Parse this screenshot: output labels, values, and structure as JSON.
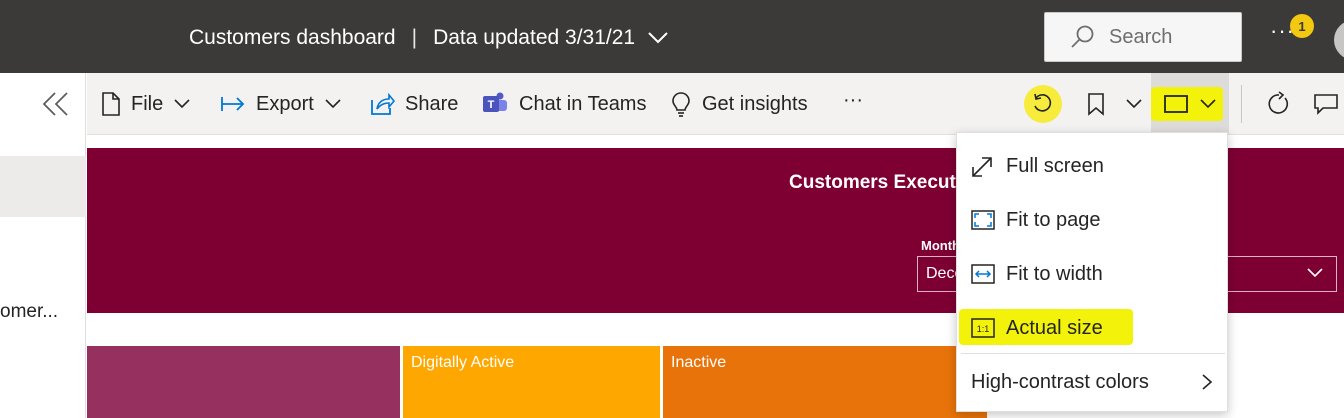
{
  "header": {
    "report_name": "Customers dashboard",
    "separator": "|",
    "data_updated": "Data updated 3/31/21",
    "search_placeholder": "Search",
    "more": "···",
    "notification_count": "1"
  },
  "leftnav": {
    "item_label": "omer..."
  },
  "toolbar": {
    "file": "File",
    "export": "Export",
    "share": "Share",
    "chat_in_teams": "Chat in Teams",
    "get_insights": "Get insights",
    "more": "···"
  },
  "report": {
    "title": "Customers Execut",
    "month_label": "Month",
    "month_value": "Dece",
    "treemap": [
      {
        "label": "",
        "color": "#96305e"
      },
      {
        "label": "Digitally Active",
        "color": "#fda700"
      },
      {
        "label": "Inactive",
        "color": "#e8730a"
      }
    ],
    "banner_color": "#7e0033"
  },
  "view_menu": {
    "items": [
      {
        "label": "Full screen",
        "icon": "full-screen-icon"
      },
      {
        "label": "Fit to page",
        "icon": "fit-to-page-icon"
      },
      {
        "label": "Fit to width",
        "icon": "fit-to-width-icon"
      },
      {
        "label": "Actual size",
        "icon": "actual-size-icon"
      }
    ],
    "high_contrast": "High-contrast colors"
  },
  "colors": {
    "topbar": "#3b3a39",
    "highlight": "#f2f20a",
    "accent_blue": "#0078d4"
  }
}
